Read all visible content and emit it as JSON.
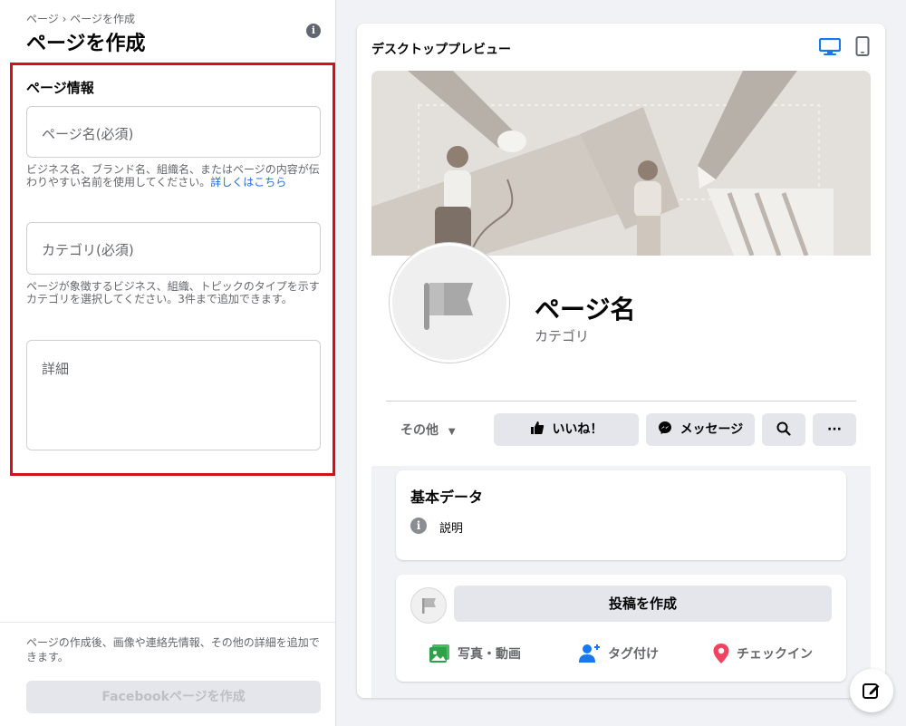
{
  "left": {
    "breadcrumb": "ページ › ページを作成",
    "title": "ページを作成",
    "section_title": "ページ情報",
    "name_placeholder": "ページ名(必須)",
    "name_help": "ビジネス名、ブランド名、組織名、またはページの内容が伝わりやすい名前を使用してください。",
    "name_help_link": "詳しくはこちら",
    "category_placeholder": "カテゴリ(必須)",
    "category_help": "ページが象徴するビジネス、組織、トピックのタイプを示すカテゴリを選択してください。3件まで追加できます。",
    "details_placeholder": "詳細",
    "bottom_note": "ページの作成後、画像や連絡先情報、その他の詳細を追加できます。",
    "create_button": "Facebookページを作成"
  },
  "preview": {
    "title": "デスクトッププレビュー",
    "page_name": "ページ名",
    "category": "カテゴリ",
    "more_dropdown": "その他",
    "like_button": "いいね！",
    "message_button": "メッセージ",
    "more_button": "···",
    "about_title": "基本データ",
    "about_description": "説明",
    "create_post": "投稿を作成",
    "photo_video": "写真・動画",
    "tag": "タグ付け",
    "checkin": "チェックイン"
  },
  "colors": {
    "accent": "#1877f2",
    "highlight_border": "#d0121b",
    "button_bg": "#e4e6eb"
  }
}
